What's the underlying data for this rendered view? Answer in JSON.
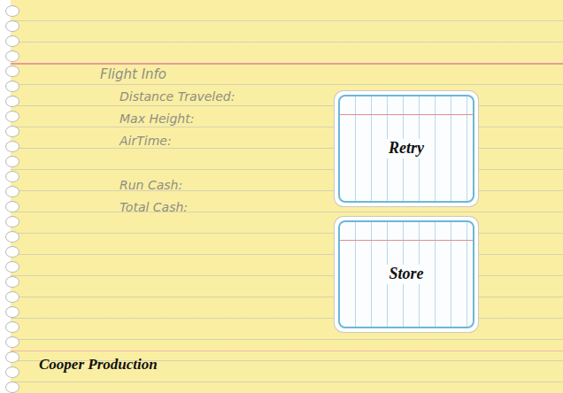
{
  "panel": {
    "title": "Flight Info",
    "stats": [
      {
        "label": "Distance Traveled:"
      },
      {
        "label": "Max Height:"
      },
      {
        "label": "AirTime:"
      }
    ],
    "cash": [
      {
        "label": "Run Cash:"
      },
      {
        "label": "Total Cash:"
      }
    ]
  },
  "buttons": [
    {
      "label": "Retry"
    },
    {
      "label": "Store"
    }
  ],
  "footer": {
    "credit": "Cooper Production"
  }
}
